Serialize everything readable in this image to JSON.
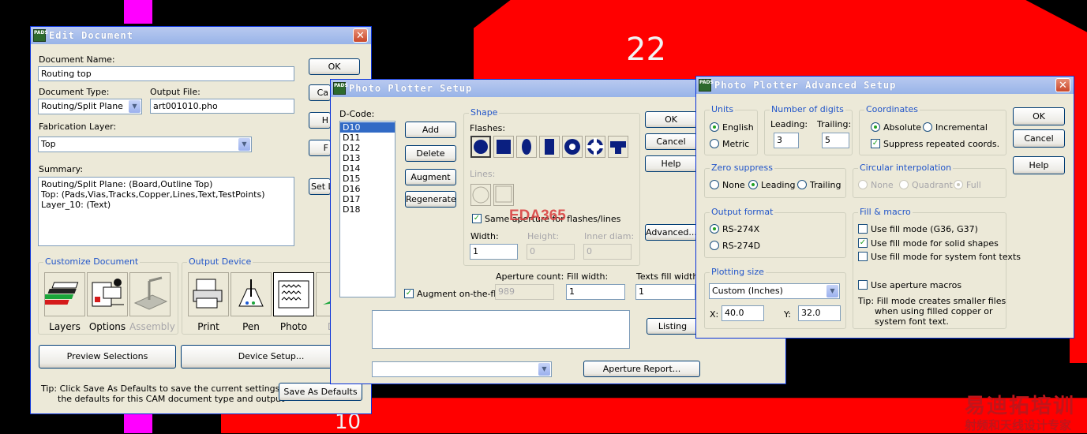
{
  "background": {
    "pad_label_top": "22",
    "pad_label_bottom": "10",
    "watermark_line1": "易迪拓培训",
    "watermark_line2": "射频和天线设计专家",
    "overlay_watermark": "EDA365"
  },
  "edit_document": {
    "title": "Edit Document",
    "doc_name_label": "Document Name:",
    "doc_name_value": "Routing top",
    "doc_type_label": "Document Type:",
    "doc_type_value": "Routing/Split Plane",
    "output_file_label": "Output File:",
    "output_file_value": "art001010.pho",
    "fab_layer_label": "Fabrication Layer:",
    "fab_layer_value": "Top",
    "summary_label": "Summary:",
    "summary_lines": [
      "Routing/Split Plane: (Board,Outline Top)",
      "Top: (Pads,Vias,Tracks,Copper,Lines,Text,TestPoints)",
      "Layer_10: (Text)"
    ],
    "ok": "OK",
    "cancel_partial": "Ca",
    "help_partial": "H",
    "f_partial": "F",
    "set_partial": "Set L",
    "customize_label": "Customize Document",
    "customize_items": [
      "Layers",
      "Options",
      "Assembly"
    ],
    "output_device_label": "Output Device",
    "output_items": [
      "Print",
      "Pen",
      "Photo",
      "Drill"
    ],
    "preview_btn": "Preview Selections",
    "device_setup_btn": "Device Setup...",
    "tip": "Tip: Click Save As Defaults to save the current settings as",
    "tip2": "the defaults for this CAM document type and output",
    "save_defaults_btn": "Save As Defaults"
  },
  "photo_plotter": {
    "title": "Photo Plotter Setup",
    "dcode_label": "D-Code:",
    "dcodes": [
      "D10",
      "D11",
      "D12",
      "D13",
      "D14",
      "D15",
      "D16",
      "D17",
      "D18"
    ],
    "add": "Add",
    "delete": "Delete",
    "augment": "Augment",
    "regenerate": "Regenerate",
    "shape_label": "Shape",
    "flashes_label": "Flashes:",
    "lines_label": "Lines:",
    "same_aperture": "Same aperture for flashes/lines",
    "width_label": "Width:",
    "width_value": "1",
    "height_label": "Height:",
    "height_value": "0",
    "inner_label": "Inner diam:",
    "inner_value": "0",
    "ok": "OK",
    "cancel": "Cancel",
    "help": "Help",
    "advanced": "Advanced...",
    "augment_fly": "Augment on-the-fly",
    "aperture_count_label": "Aperture count:",
    "aperture_count_value": "989",
    "fill_width_label": "Fill width:",
    "fill_width_value": "1",
    "texts_fill_label": "Texts fill width:",
    "texts_fill_value": "1",
    "listing": "Listing",
    "aperture_report": "Aperture Report..."
  },
  "advanced": {
    "title": "Photo Plotter Advanced Setup",
    "units_label": "Units",
    "english": "English",
    "metric": "Metric",
    "digits_label": "Number of digits",
    "leading_label": "Leading:",
    "leading_value": "3",
    "trailing_label": "Trailing:",
    "trailing_value": "5",
    "coords_label": "Coordinates",
    "absolute": "Absolute",
    "incremental": "Incremental",
    "suppress_coords": "Suppress repeated coords.",
    "zero_label": "Zero suppress",
    "none": "None",
    "leading": "Leading",
    "trailing": "Trailing",
    "circ_label": "Circular interpolation",
    "circ_none": "None",
    "quadrant": "Quadrant",
    "full": "Full",
    "output_format_label": "Output format",
    "rs274x": "RS-274X",
    "rs274d": "RS-274D",
    "fill_macro_label": "Fill & macro",
    "fill_g36": "Use fill mode (G36, G37)",
    "fill_solid": "Use fill mode for solid shapes",
    "fill_font": "Use fill mode for system font texts",
    "use_macros": "Use aperture macros",
    "plot_size_label": "Plotting size",
    "plot_size_value": "Custom (Inches)",
    "x_label": "X:",
    "x_value": "40.0",
    "y_label": "Y:",
    "y_value": "32.0",
    "tip1": "Tip: Fill mode creates smaller files",
    "tip2": "when using filled copper or",
    "tip3": "system font text.",
    "ok": "OK",
    "cancel": "Cancel",
    "help": "Help"
  }
}
